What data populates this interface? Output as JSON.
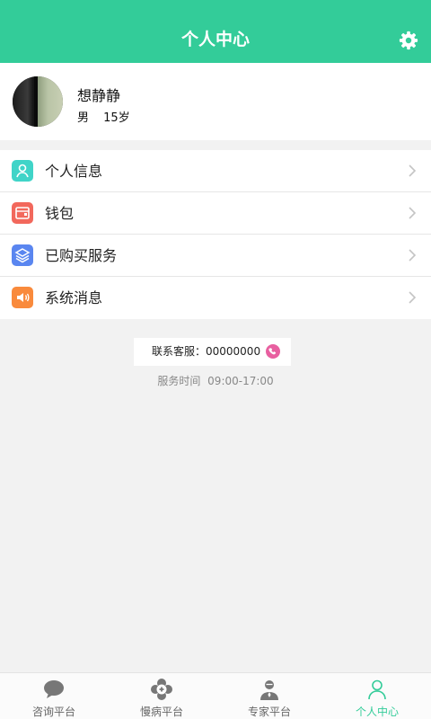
{
  "header": {
    "title": "个人中心",
    "settings_icon": "gear-icon",
    "bg_color": "#33cc99"
  },
  "profile": {
    "name": "想静静",
    "gender": "男",
    "age": "15岁"
  },
  "menu": {
    "items": [
      {
        "label": "个人信息",
        "icon": "person-icon",
        "color": "#40d4c8"
      },
      {
        "label": "钱包",
        "icon": "wallet-icon",
        "color": "#f2685c"
      },
      {
        "label": "已购买服务",
        "icon": "layers-icon",
        "color": "#5a86f0"
      },
      {
        "label": "系统消息",
        "icon": "speaker-icon",
        "color": "#f98a3c"
      }
    ]
  },
  "service": {
    "label": "联系客服：00000000",
    "phone_icon": "phone-icon",
    "hours_label": "服务时间",
    "hours_value": "09:00-17:00"
  },
  "tabs": [
    {
      "label": "咨询平台",
      "icon": "chat-bubble-icon",
      "active": false
    },
    {
      "label": "慢病平台",
      "icon": "medical-badge-icon",
      "active": false
    },
    {
      "label": "专家平台",
      "icon": "doctor-icon",
      "active": false
    },
    {
      "label": "个人中心",
      "icon": "user-outline-icon",
      "active": true
    }
  ],
  "colors": {
    "accent": "#33cc99",
    "inactive_tab": "#777777"
  }
}
